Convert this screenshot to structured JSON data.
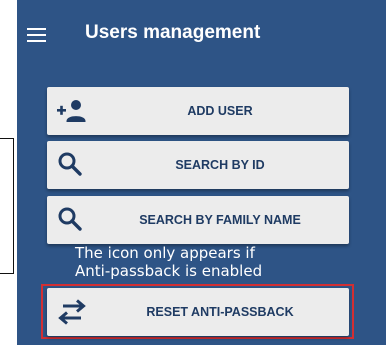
{
  "header": {
    "title": "Users management",
    "menu_icon": "hamburger-menu-icon"
  },
  "buttons": [
    {
      "label": "ADD USER",
      "icon": "add-user-icon"
    },
    {
      "label": "SEARCH BY ID",
      "icon": "search-icon"
    },
    {
      "label": "SEARCH BY FAMILY NAME",
      "icon": "search-icon"
    },
    {
      "label": "RESET ANTI-PASSBACK",
      "icon": "swap-arrows-icon"
    }
  ],
  "annotation": {
    "line1": "The icon only appears if",
    "line2": "Anti-passback is enabled"
  },
  "colors": {
    "panel_background": "#2e5486",
    "button_background": "#ececec",
    "button_text": "#1f3b63",
    "highlight_border": "#d22f33"
  }
}
